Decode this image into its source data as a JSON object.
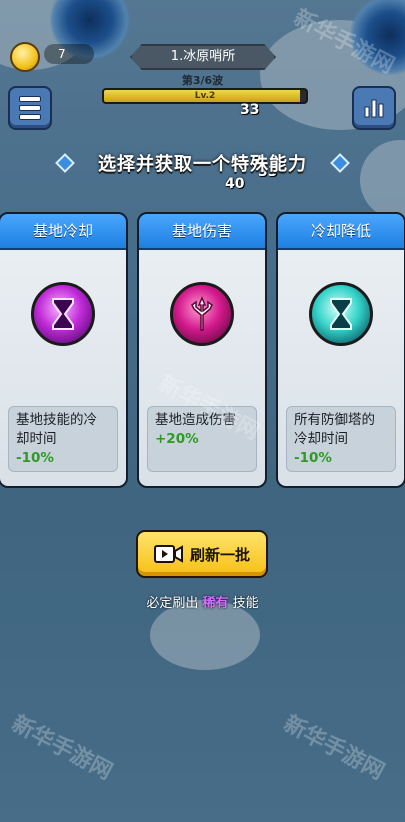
{
  "hud": {
    "coins": "7",
    "stage": "1.冰原哨所",
    "wave": "第3/6波",
    "level_label": "Lv.2",
    "hp_fraction": 0.97,
    "damage_numbers": [
      "33",
      "33",
      "40"
    ]
  },
  "prompt": {
    "title": "选择并获取一个特殊能力"
  },
  "cards": [
    {
      "title": "基地冷却",
      "icon": "hourglass-icon",
      "desc": "基地技能的冷却时间",
      "value": "-10%",
      "icon_style": "purple"
    },
    {
      "title": "基地伤害",
      "icon": "trident-icon",
      "desc": "基地造成伤害",
      "value": "+20%",
      "icon_style": "magenta"
    },
    {
      "title": "冷却降低",
      "icon": "hourglass-icon",
      "desc": "所有防御塔的冷却时间",
      "value": "-10%",
      "icon_style": "cyan"
    }
  ],
  "refresh": {
    "label": "刷新一批",
    "icon": "video-play-icon",
    "note_prefix": "必定刷出",
    "note_rare": "稀有",
    "note_suffix": "技能"
  },
  "watermark": "新华手游网",
  "colors": {
    "header": "#2b8df0",
    "positive": "#2f9b24",
    "rare": "#d46cff",
    "button": "#f6bf14"
  }
}
